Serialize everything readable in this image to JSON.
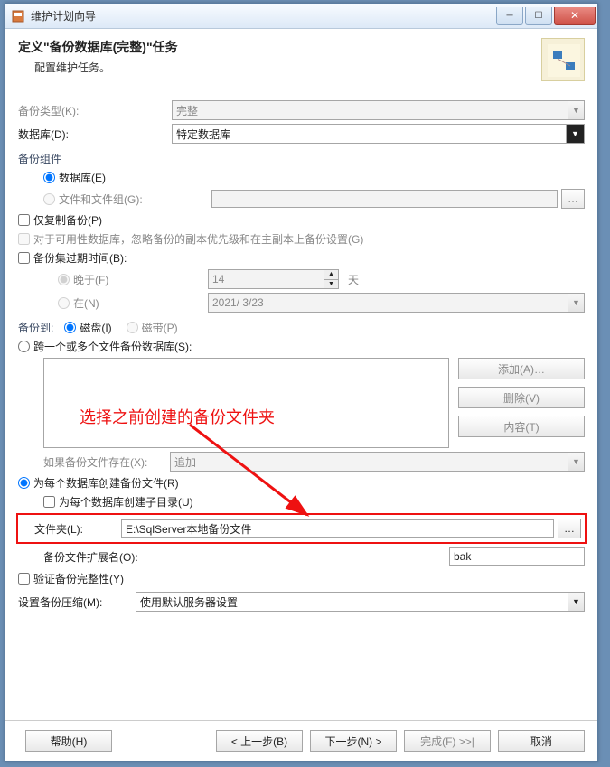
{
  "window": {
    "title": "维护计划向导"
  },
  "header": {
    "title": "定义\"备份数据库(完整)\"任务",
    "subtitle": "配置维护任务。"
  },
  "backupType": {
    "label": "备份类型(K):",
    "value": "完整"
  },
  "databases": {
    "label": "数据库(D):",
    "value": "特定数据库"
  },
  "component": {
    "title": "备份组件",
    "databaseLabel": "数据库(E)",
    "filesLabel": "文件和文件组(G):"
  },
  "copyOnly": {
    "label": "仅复制备份(P)"
  },
  "availability": {
    "label": "对于可用性数据库，忽略备份的副本优先级和在主副本上备份设置(G)"
  },
  "expiry": {
    "title": "备份集过期时间(B):",
    "afterLabel": "晚于(F)",
    "afterValue": "14",
    "afterUnit": "天",
    "onLabel": "在(N)",
    "onValue": "2021/ 3/23"
  },
  "backupTo": {
    "label": "备份到:",
    "diskLabel": "磁盘(I)",
    "tapeLabel": "磁带(P)"
  },
  "multiFile": {
    "label": "跨一个或多个文件备份数据库(S):",
    "addBtn": "添加(A)…",
    "removeBtn": "删除(V)",
    "contentsBtn": "内容(T)",
    "existsLabel": "如果备份文件存在(X):",
    "existsValue": "追加"
  },
  "perDb": {
    "label": "为每个数据库创建备份文件(R)",
    "subdirLabel": "为每个数据库创建子目录(U)",
    "folderLabel": "文件夹(L):",
    "folderValue": "E:\\SqlServer本地备份文件",
    "extLabel": "备份文件扩展名(O):",
    "extValue": "bak"
  },
  "verify": {
    "label": "验证备份完整性(Y)"
  },
  "compression": {
    "label": "设置备份压缩(M):",
    "value": "使用默认服务器设置"
  },
  "buttons": {
    "help": "帮助(H)",
    "back": "< 上一步(B)",
    "next": "下一步(N) >",
    "finish": "完成(F) >>|",
    "cancel": "取消"
  },
  "annotation": "选择之前创建的备份文件夹"
}
